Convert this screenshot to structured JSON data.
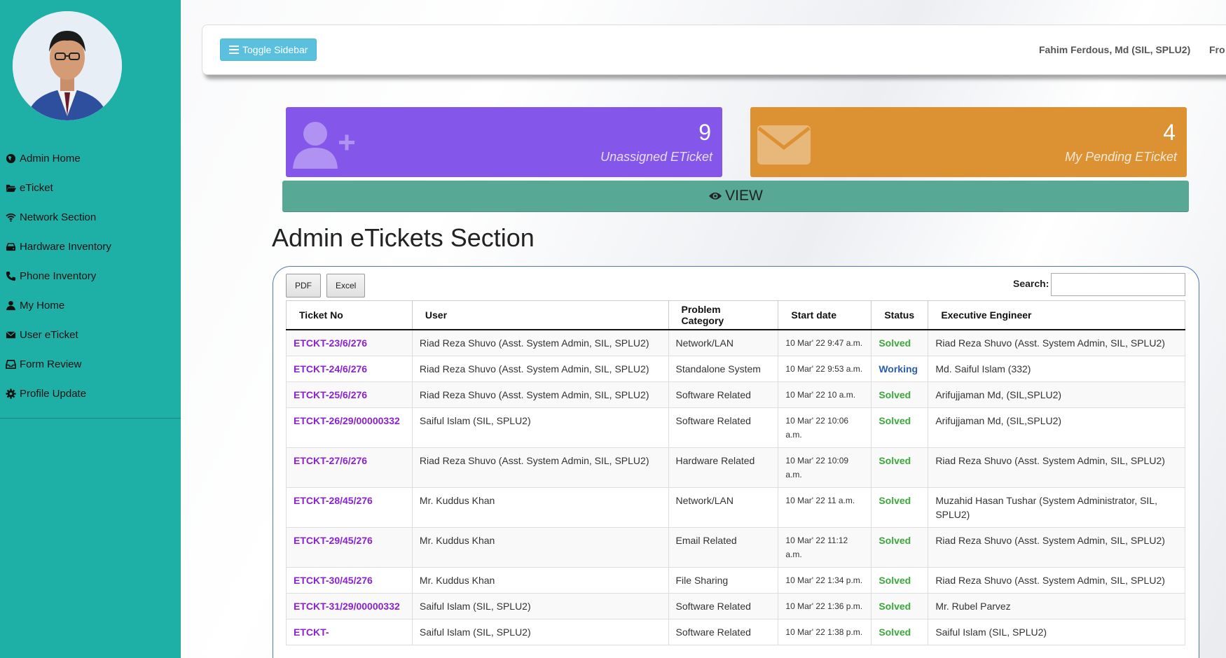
{
  "sidebar": {
    "items": [
      {
        "label": "Admin Home",
        "icon": "globe-icon"
      },
      {
        "label": "eTicket",
        "icon": "folder-open-icon"
      },
      {
        "label": "Network Section",
        "icon": "wifi-icon"
      },
      {
        "label": "Hardware Inventory",
        "icon": "hdd-icon"
      },
      {
        "label": "Phone Inventory",
        "icon": "phone-icon"
      },
      {
        "label": "My Home",
        "icon": "user-icon"
      },
      {
        "label": "User eTicket",
        "icon": "envelope-icon"
      },
      {
        "label": "Form Review",
        "icon": "inbox-icon"
      },
      {
        "label": "Profile Update",
        "icon": "gear-icon"
      }
    ]
  },
  "topbar": {
    "toggle_label": "Toggle Sidebar",
    "user_name": "Fahim Ferdous, Md (SIL, SPLU2)",
    "extra": "Fro"
  },
  "cards": {
    "unassigned": {
      "count": "9",
      "label": "Unassigned ETicket"
    },
    "pending": {
      "count": "4",
      "label": "My Pending ETicket"
    }
  },
  "view_label": "VIEW",
  "section_title": "Admin eTickets Section",
  "table_tools": {
    "pdf": "PDF",
    "excel": "Excel",
    "search_label": "Search:"
  },
  "table": {
    "headers": [
      "Ticket No",
      "User",
      "Problem Category",
      "Start date",
      "Status",
      "Executive Engineer"
    ],
    "rows": [
      [
        "ETCKT-23/6/276",
        "Riad Reza Shuvo (Asst. System Admin, SIL, SPLU2)",
        "Network/LAN",
        "10 Mar' 22 9:47 a.m.",
        "Solved",
        "Riad Reza Shuvo (Asst. System Admin, SIL, SPLU2)"
      ],
      [
        "ETCKT-24/6/276",
        "Riad Reza Shuvo (Asst. System Admin, SIL, SPLU2)",
        "Standalone System",
        "10 Mar' 22 9:53 a.m.",
        "Working",
        "Md. Saiful Islam (332)"
      ],
      [
        "ETCKT-25/6/276",
        "Riad Reza Shuvo (Asst. System Admin, SIL, SPLU2)",
        "Software Related",
        "10 Mar' 22 10 a.m.",
        "Solved",
        "Arifujjaman Md, (SIL,SPLU2)"
      ],
      [
        "ETCKT-26/29/00000332",
        "Saiful Islam (SIL, SPLU2)",
        "Software Related",
        "10 Mar' 22 10:06 a.m.",
        "Solved",
        "Arifujjaman Md, (SIL,SPLU2)"
      ],
      [
        "ETCKT-27/6/276",
        "Riad Reza Shuvo (Asst. System Admin, SIL, SPLU2)",
        "Hardware Related",
        "10 Mar' 22 10:09 a.m.",
        "Solved",
        "Riad Reza Shuvo (Asst. System Admin, SIL, SPLU2)"
      ],
      [
        "ETCKT-28/45/276",
        "Mr. Kuddus Khan",
        "Network/LAN",
        "10 Mar' 22 11 a.m.",
        "Solved",
        "Muzahid Hasan Tushar (System Administrator, SIL, SPLU2)"
      ],
      [
        "ETCKT-29/45/276",
        "Mr. Kuddus Khan",
        "Email Related",
        "10 Mar' 22 11:12 a.m.",
        "Solved",
        "Riad Reza Shuvo (Asst. System Admin, SIL, SPLU2)"
      ],
      [
        "ETCKT-30/45/276",
        "Mr. Kuddus Khan",
        "File Sharing",
        "10 Mar' 22 1:34 p.m.",
        "Solved",
        "Riad Reza Shuvo (Asst. System Admin, SIL, SPLU2)"
      ],
      [
        "ETCKT-31/29/00000332",
        "Saiful Islam (SIL, SPLU2)",
        "Software Related",
        "10 Mar' 22 1:36 p.m.",
        "Solved",
        "Mr. Rubel Parvez"
      ],
      [
        "ETCKT-",
        "Saiful Islam (SIL, SPLU2)",
        "Software Related",
        "10 Mar' 22 1:38 p.m.",
        "Solved",
        "Saiful Islam (SIL, SPLU2)"
      ]
    ]
  },
  "colors": {
    "sidebar": "#1eb0a6",
    "card_purple": "#8457ea",
    "card_orange": "#dc9233",
    "view_bar": "#58a896",
    "ticket_link": "#8a22d0",
    "solved": "#3aa83a",
    "working": "#2a5db0"
  }
}
